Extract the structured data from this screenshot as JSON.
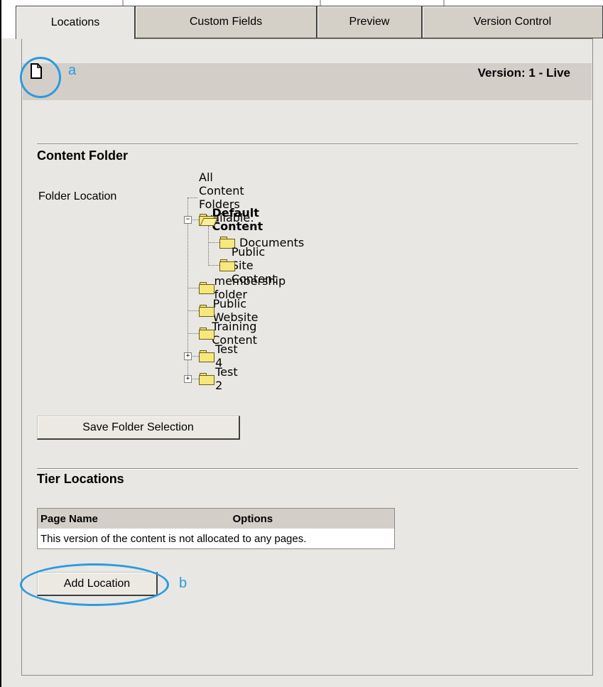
{
  "tabs": [
    {
      "label": "Locations",
      "active": true
    },
    {
      "label": "Custom Fields",
      "active": false
    },
    {
      "label": "Preview",
      "active": false
    },
    {
      "label": "Version Control",
      "active": false
    }
  ],
  "version_bar": {
    "version_text": "Version: 1 - Live",
    "icon": "document-icon"
  },
  "annotations": {
    "a": "a",
    "b": "b",
    "color": "#2a9be0"
  },
  "content_folder": {
    "title": "Content Folder",
    "folder_location_label": "Folder Location",
    "tree_root": "All Content Folders available:",
    "default_content": "Default Content",
    "documents": "Documents",
    "public_site_content": "Public Site Content",
    "membership_folder": "membership folder",
    "public_website": "Public Website",
    "training_content": "Training Content",
    "test4": "Test 4",
    "test2": "Test 2",
    "save_button": "Save Folder Selection"
  },
  "tier_locations": {
    "title": "Tier Locations",
    "table": {
      "headers": [
        "Page Name",
        "Options"
      ],
      "rows": [
        [
          "This version of the content is not allocated to any pages."
        ]
      ]
    },
    "add_button": "Add Location"
  },
  "colors": {
    "panel_bg": "#e9e7e3",
    "bar_bg": "#d3cfc8",
    "accent": "#2a9be0"
  }
}
